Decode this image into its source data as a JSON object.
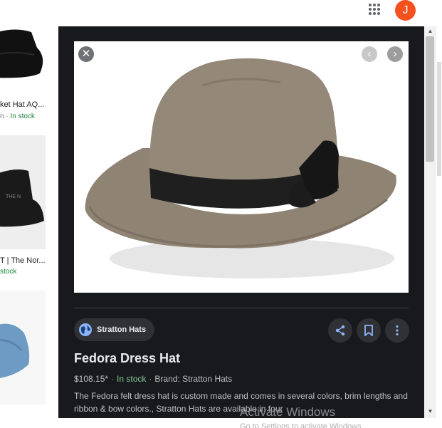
{
  "header": {
    "avatar_letter": "J",
    "avatar_color": "#f4511e",
    "apps_icon": "apps-grid-icon"
  },
  "results": [
    {
      "title": "ket Hat AQ...",
      "price_fragment": "n",
      "stock": "In stock"
    },
    {
      "title": "T | The Nor...",
      "stock": "stock"
    }
  ],
  "viewer": {
    "close_icon": "close-icon",
    "prev_icon": "chevron-left-icon",
    "next_icon": "chevron-right-icon",
    "source": {
      "name": "Stratton Hats",
      "icon": "globe-icon"
    },
    "actions": {
      "share_icon": "share-icon",
      "save_icon": "bookmark-icon",
      "more_icon": "more-vert-icon"
    },
    "product": {
      "title": "Fedora Dress Hat",
      "price": "$108.15*",
      "stock": "In stock",
      "brand": "Brand: Stratton Hats",
      "description": "The Fedora felt dress hat is custom made and comes in several colors, brim lengths and ribbon & bow colors., Stratton Hats are available in four"
    }
  },
  "os": {
    "watermark_title": "Activate Windows",
    "watermark_sub": "Go to Settings to activate Windows."
  },
  "colors": {
    "panel_bg": "#18191d",
    "chip_bg": "#303134",
    "stock_green": "#81c995",
    "accent_blue": "#8ab4f8"
  }
}
